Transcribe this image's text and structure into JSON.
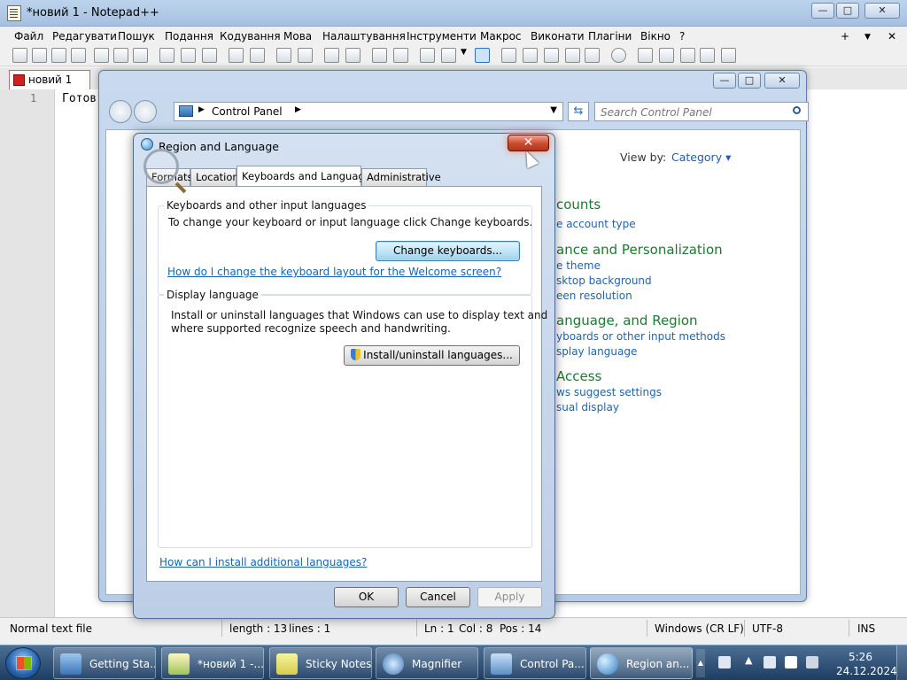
{
  "npp": {
    "title": "*новий 1 - Notepad++",
    "menu": [
      "Файл",
      "Редагувати",
      "Пошук",
      "Подання",
      "Кодування",
      "Мова",
      "Налаштування",
      "Інструменти",
      "Макрос",
      "Виконати",
      "Плагіни",
      "Вікно",
      "?"
    ],
    "menu_extra": [
      "+",
      "▼",
      "✕"
    ],
    "tab": "новий 1",
    "line_number": "1",
    "code": "Готов",
    "status": {
      "doc_type": "Normal text file",
      "length": "length : 13",
      "lines": "lines : 1",
      "ln": "Ln : 1",
      "col": "Col : 8",
      "pos": "Pos : 14",
      "eol": "Windows (CR LF)",
      "encoding": "UTF-8",
      "mode": "INS"
    }
  },
  "control_panel": {
    "breadcrumb": "Control Panel",
    "search_placeholder": "Search Control Panel",
    "view_by_label": "View by:",
    "view_by_value": "Category ▾",
    "sections": [
      {
        "heading": "counts",
        "links": [
          "e account type"
        ]
      },
      {
        "heading": "ance and Personalization",
        "links": [
          "e theme",
          "sktop background",
          "een resolution"
        ]
      },
      {
        "heading": "anguage, and Region",
        "links": [
          "yboards or other input methods",
          "splay language"
        ]
      },
      {
        "heading": "Access",
        "links": [
          "ws suggest settings",
          "sual display"
        ]
      }
    ]
  },
  "dialog": {
    "title": "Region and Language",
    "tabs": [
      "Formats",
      "Location",
      "Keyboards and Languages",
      "Administrative"
    ],
    "keyboards_group": {
      "title": "Keyboards and other input languages",
      "text": "To change your keyboard or input language click Change keyboards.",
      "button": "Change keyboards...",
      "link": "How do I change the keyboard layout for the Welcome screen?"
    },
    "display_group": {
      "title": "Display language",
      "text_1": "Install or uninstall languages that Windows can use to display text and",
      "text_2": "where supported recognize speech and handwriting.",
      "button": "Install/uninstall languages..."
    },
    "bottom_link": "How can I install additional languages?",
    "ok": "OK",
    "cancel": "Cancel",
    "apply": "Apply"
  },
  "taskbar": {
    "items": [
      "Getting Sta...",
      "*новий 1 -...",
      "Sticky Notes",
      "Magnifier",
      "Control Pa...",
      "Region an..."
    ],
    "time": "5:26",
    "date": "24.12.2024"
  }
}
